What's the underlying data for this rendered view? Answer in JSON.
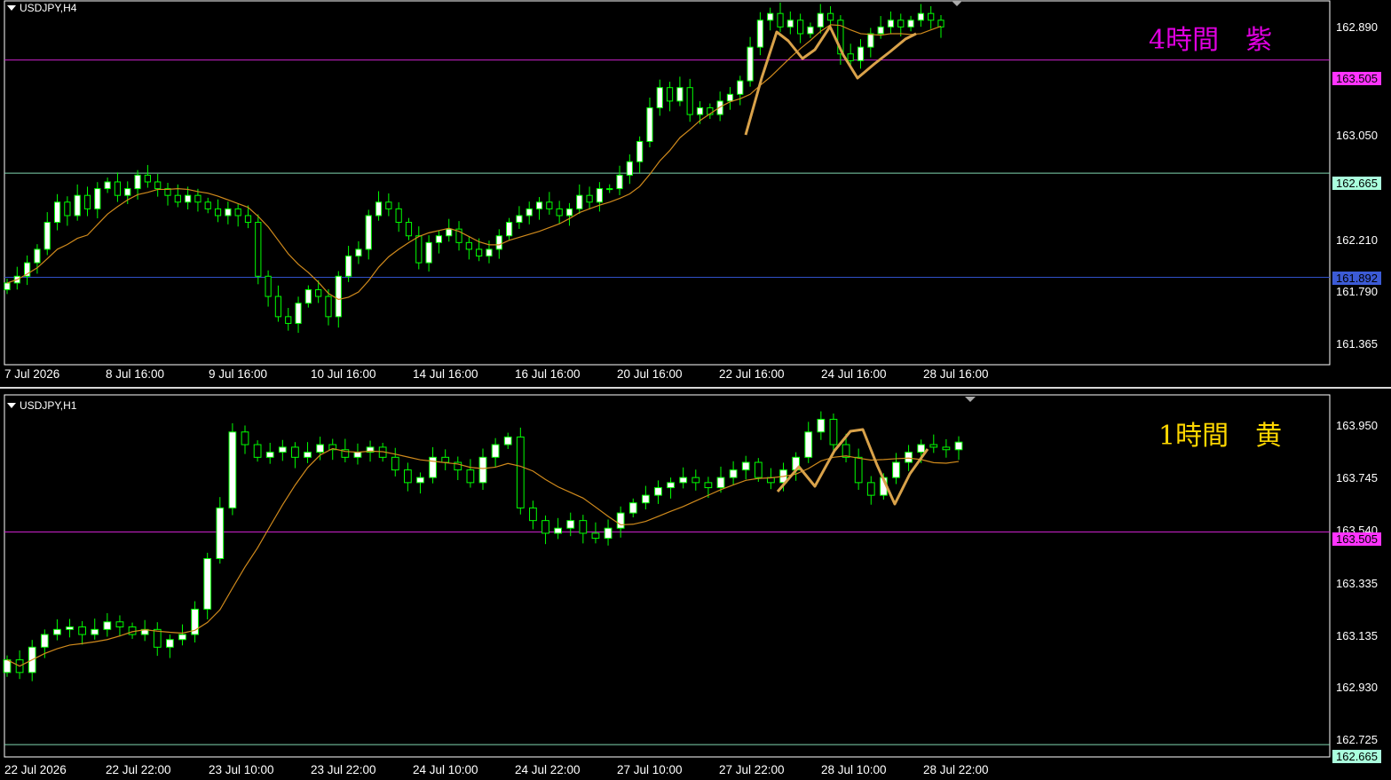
{
  "panes": {
    "h4": {
      "title": "USDJPY,H4",
      "annotation": "4時間　紫",
      "annotation_color": "#e000e0",
      "price_ticks": [
        "162.890",
        "163.050",
        "162.210",
        "161.790",
        "161.365"
      ],
      "price_badges": [
        {
          "value": "163.505",
          "color": "#ff33ff"
        },
        {
          "value": "162.665",
          "color": "#aaffdd"
        },
        {
          "value": "161.892",
          "color": "#3c5bd6"
        }
      ],
      "time_labels": [
        "7 Jul 2026",
        "8 Jul 16:00",
        "9 Jul 16:00",
        "10 Jul 16:00",
        "14 Jul 16:00",
        "16 Jul 16:00",
        "20 Jul 16:00",
        "22 Jul 16:00",
        "24 Jul 16:00",
        "28 Jul 16:00"
      ]
    },
    "h1": {
      "title": "USDJPY,H1",
      "annotation": "1時間　黄",
      "annotation_color": "#ffd700",
      "price_ticks": [
        "163.950",
        "163.745",
        "163.540",
        "163.335",
        "163.135",
        "162.930",
        "162.725"
      ],
      "price_badges": [
        {
          "value": "163.505",
          "color": "#ff33ff"
        },
        {
          "value": "162.665",
          "color": "#aaffdd"
        }
      ],
      "time_labels": [
        "22 Jul 2026",
        "22 Jul 22:00",
        "23 Jul 10:00",
        "23 Jul 22:00",
        "24 Jul 10:00",
        "24 Jul 22:00",
        "27 Jul 10:00",
        "27 Jul 22:00",
        "28 Jul 10:00",
        "28 Jul 22:00"
      ]
    }
  },
  "colors": {
    "candle_up_body": "#ffffff",
    "candle_down_body": "#000000",
    "candle_wick": "#00ff00",
    "moving_average": "#d08a1c",
    "zigzag": "#d9a24a",
    "axis_text": "#ffffff",
    "background": "#000000"
  },
  "chart_data": [
    {
      "type": "candlestick",
      "symbol": "USDJPY",
      "timeframe": "H4",
      "horizontal_lines": [
        163.505,
        162.665,
        161.892
      ],
      "series": [
        {
          "name": "price",
          "values": [
            161.85,
            161.9,
            162.0,
            162.1,
            162.3,
            162.45,
            162.35,
            162.5,
            162.4,
            162.55,
            162.6,
            162.5,
            162.55,
            162.65,
            162.6,
            162.55,
            162.5,
            162.45,
            162.5,
            162.45,
            162.4,
            162.35,
            162.4,
            162.35,
            162.3,
            161.9,
            161.75,
            161.6,
            161.55,
            161.7,
            161.8,
            161.75,
            161.6,
            161.9,
            162.05,
            162.1,
            162.35,
            162.45,
            162.4,
            162.3,
            162.2,
            162.0,
            162.15,
            162.2,
            162.25,
            162.15,
            162.1,
            162.05,
            162.1,
            162.2,
            162.3,
            162.35,
            162.4,
            162.45,
            162.4,
            162.35,
            162.4,
            162.5,
            162.45,
            162.55,
            162.55,
            162.65,
            162.75,
            162.9,
            163.15,
            163.3,
            163.2,
            163.3,
            163.1,
            163.15,
            163.1,
            163.2,
            163.25,
            163.35,
            163.6,
            163.8,
            163.85,
            163.75,
            163.8,
            163.7,
            163.75,
            163.85,
            163.8,
            163.55,
            163.5,
            163.6,
            163.7,
            163.75,
            163.8,
            163.75,
            163.8,
            163.85,
            163.8,
            163.75
          ]
        }
      ]
    },
    {
      "type": "candlestick",
      "symbol": "USDJPY",
      "timeframe": "H1",
      "horizontal_lines": [
        163.505,
        162.665
      ],
      "series": [
        {
          "name": "price",
          "values": [
            163.0,
            162.95,
            163.05,
            163.1,
            163.12,
            163.13,
            163.1,
            163.12,
            163.15,
            163.13,
            163.1,
            163.12,
            163.05,
            163.08,
            163.1,
            163.2,
            163.4,
            163.6,
            163.9,
            163.85,
            163.8,
            163.82,
            163.84,
            163.8,
            163.82,
            163.85,
            163.83,
            163.8,
            163.82,
            163.84,
            163.8,
            163.75,
            163.7,
            163.72,
            163.8,
            163.78,
            163.75,
            163.7,
            163.8,
            163.85,
            163.88,
            163.6,
            163.55,
            163.5,
            163.52,
            163.55,
            163.5,
            163.48,
            163.52,
            163.58,
            163.62,
            163.65,
            163.68,
            163.7,
            163.72,
            163.7,
            163.68,
            163.72,
            163.75,
            163.78,
            163.72,
            163.7,
            163.75,
            163.8,
            163.9,
            163.95,
            163.85,
            163.8,
            163.7,
            163.65,
            163.72,
            163.78,
            163.82,
            163.85,
            163.84,
            163.83,
            163.86
          ]
        }
      ]
    }
  ]
}
